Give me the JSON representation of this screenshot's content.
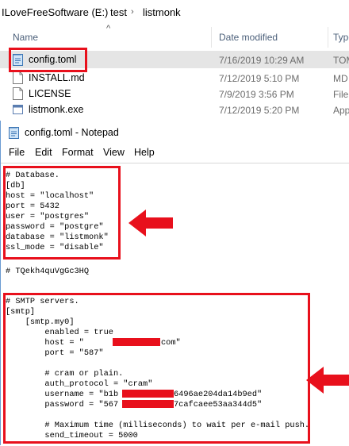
{
  "explorer": {
    "breadcrumb": [
      "ILoveFreeSoftware (E:)",
      "test",
      "listmonk"
    ],
    "columns": {
      "name": "Name",
      "date_modified": "Date modified",
      "type": "Type"
    },
    "files": [
      {
        "name": "config.toml",
        "date": "7/16/2019 10:29 AM",
        "type": "TOM"
      },
      {
        "name": "INSTALL.md",
        "date": "7/12/2019 5:10 PM",
        "type": "MD"
      },
      {
        "name": "LICENSE",
        "date": "7/9/2019 3:56 PM",
        "type": "File"
      },
      {
        "name": "listmonk.exe",
        "date": "7/12/2019 5:20 PM",
        "type": "App"
      }
    ]
  },
  "notepad": {
    "title": "config.toml - Notepad",
    "menu": [
      "File",
      "Edit",
      "Format",
      "View",
      "Help"
    ],
    "db_block": "# Database.\n[db]\nhost = \"localhost\"\nport = 5432\nuser = \"postgres\"\npassword = \"postgre\"\ndatabase = \"listmonk\"\nssl_mode = \"disable\"",
    "secret_line": "# TQekh4quVgGc3HQ",
    "smtp_block": "# SMTP servers.\n[smtp]\n    [smtp.my0]\n        enabled = true\n        host = \"\n        port = \"587\"\n\n        # cram or plain.\n        auth_protocol = \"cram\"\n        username = \"b1b\n        password = \"567\n\n        # Maximum time (milliseconds) to wait per e-mail push.\n        send_timeout = 5000",
    "host_suffix": "com\"",
    "username_suffix": "6496ae204da14b9ed\"",
    "password_suffix": "7cafcaee53aa344d5\""
  },
  "colors": {
    "annotation": "#e8101c",
    "selection": "#e5e5e5",
    "header_text": "#4c607a"
  }
}
